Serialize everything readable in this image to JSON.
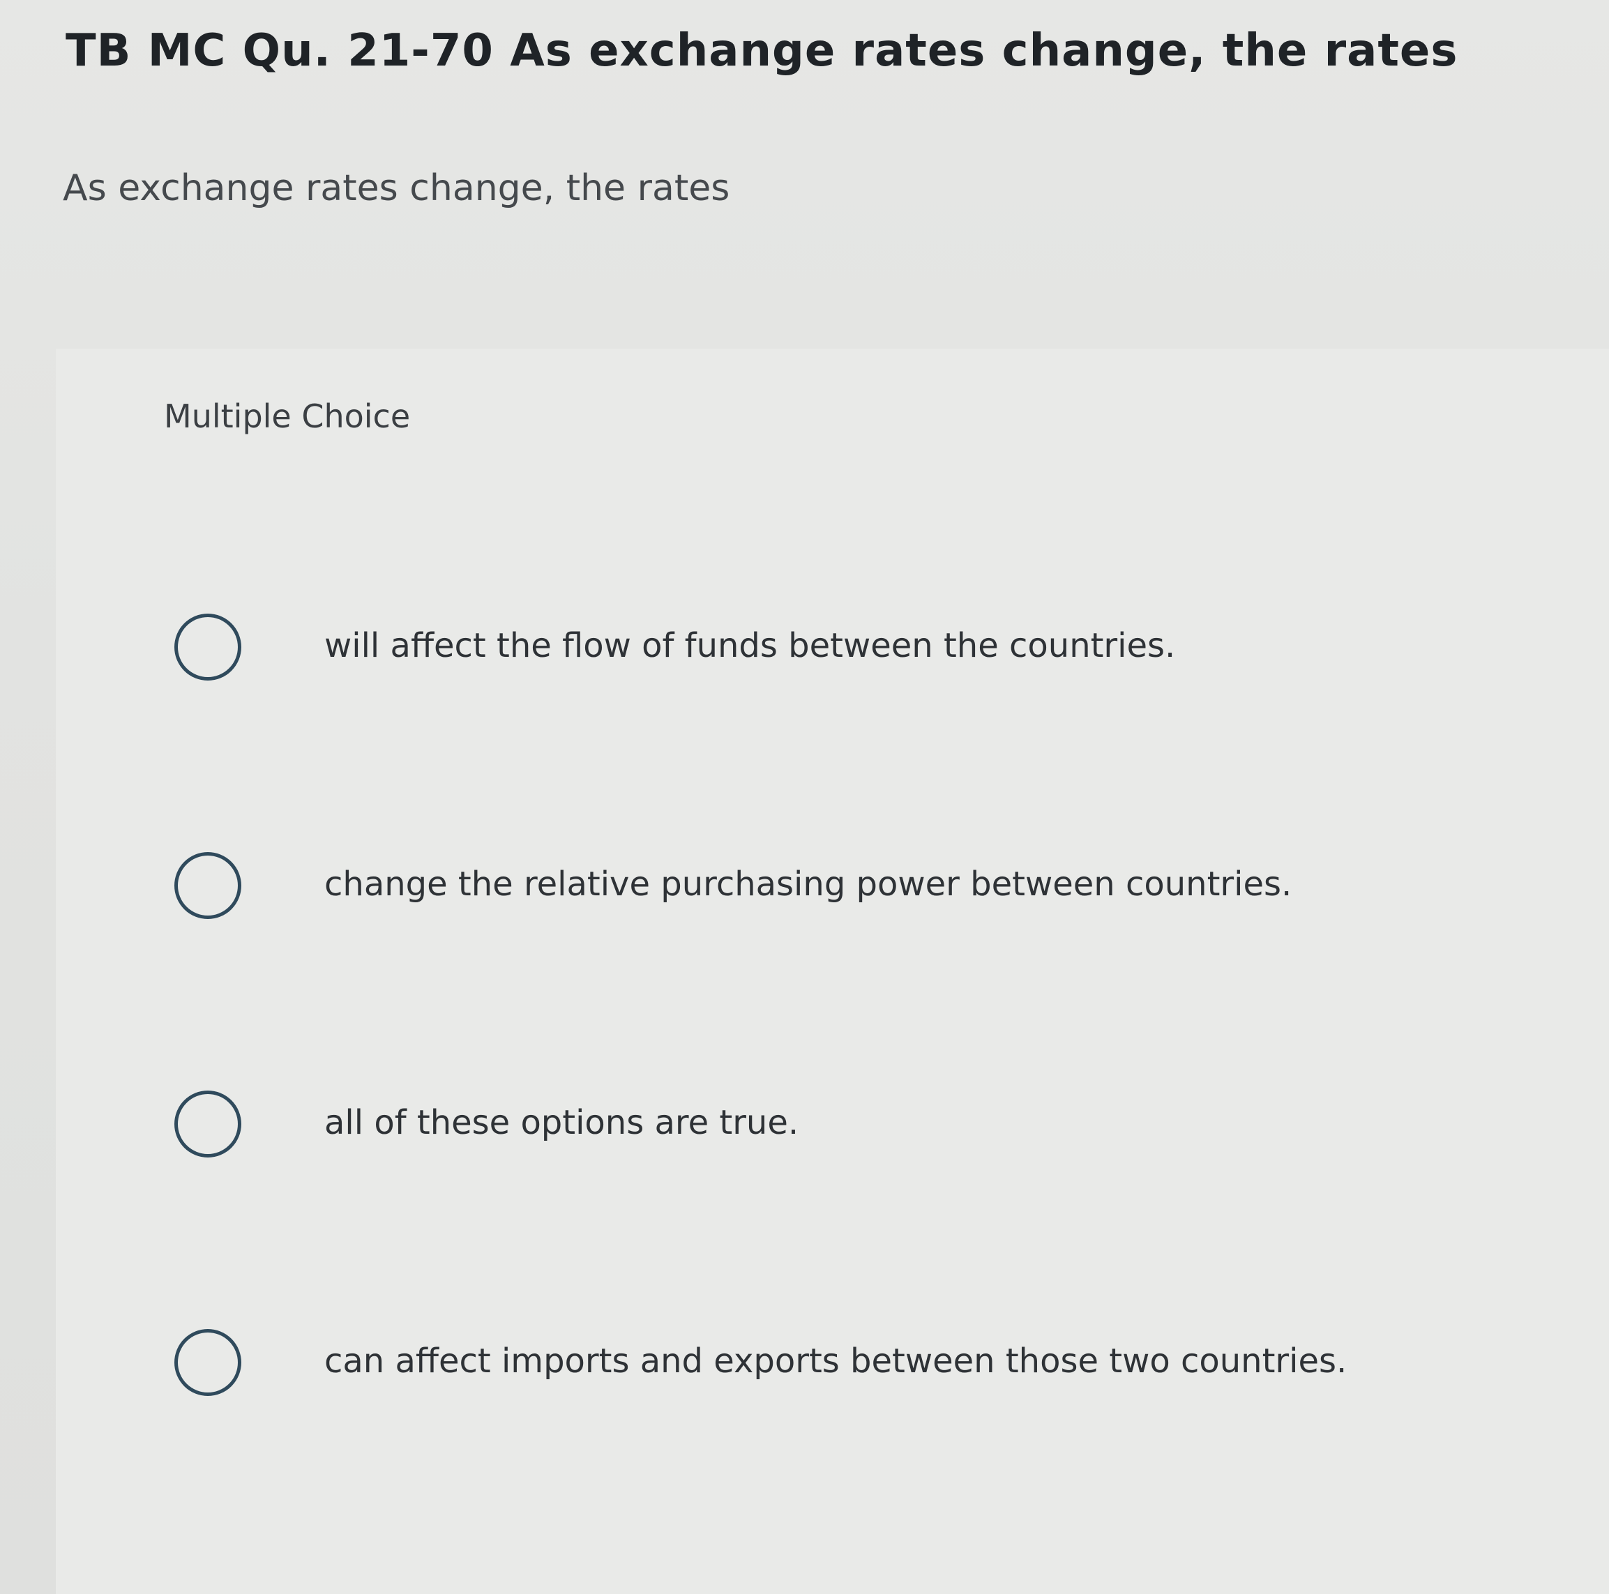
{
  "question": {
    "title": "TB MC Qu. 21-70 As exchange rates change, the rates",
    "prompt": "As exchange rates change, the rates",
    "type_label": "Multiple Choice",
    "options": [
      {
        "label": "will affect the flow of funds between the countries."
      },
      {
        "label": "change the relative purchasing power between countries."
      },
      {
        "label": "all of these options are true."
      },
      {
        "label": "can affect imports and exports between those two countries."
      }
    ]
  },
  "icons": {
    "radio": "radio-unselected-icon"
  }
}
